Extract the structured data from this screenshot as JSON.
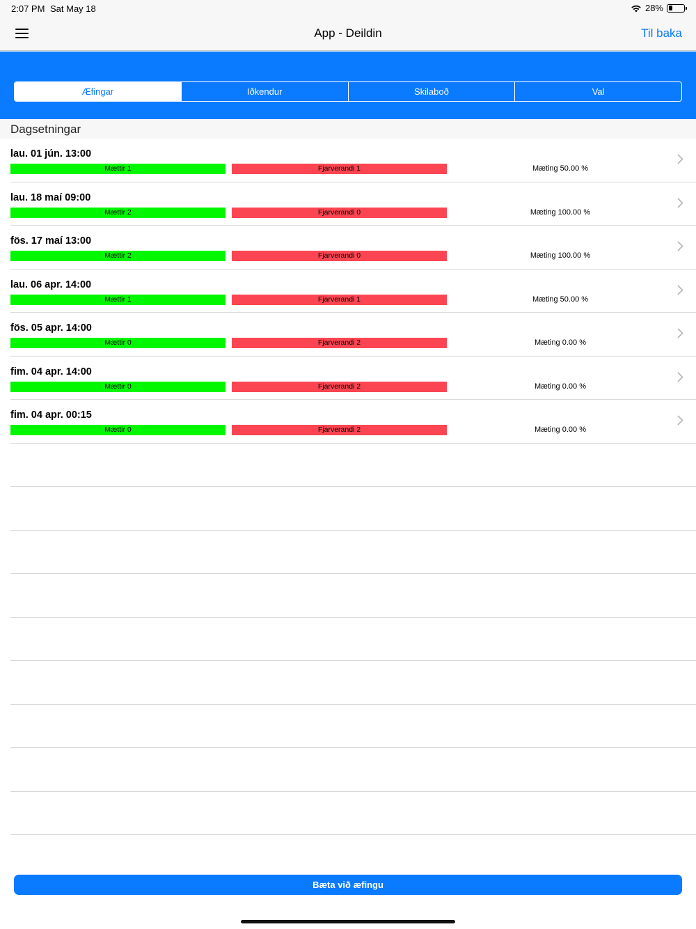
{
  "status_bar": {
    "time": "2:07 PM",
    "date": "Sat May 18",
    "battery": "28%"
  },
  "nav": {
    "title": "App - Deildin",
    "back_label": "Til baka"
  },
  "tabs": [
    {
      "label": "Æfingar",
      "active": true
    },
    {
      "label": "Iðkendur",
      "active": false
    },
    {
      "label": "Skilaboð",
      "active": false
    },
    {
      "label": "Val",
      "active": false
    }
  ],
  "section": {
    "header": "Dagsetningar"
  },
  "sessions": [
    {
      "date": "lau. 01 jún. 13:00",
      "present": "Mættir 1",
      "absent": "Fjarverandi 1",
      "attendance": "Mæting 50.00 %"
    },
    {
      "date": "lau. 18 maí 09:00",
      "present": "Mættir 2",
      "absent": "Fjarverandi 0",
      "attendance": "Mæting 100.00 %"
    },
    {
      "date": "fös. 17 maí 13:00",
      "present": "Mættir 2",
      "absent": "Fjarverandi 0",
      "attendance": "Mæting 100.00 %"
    },
    {
      "date": "lau. 06 apr. 14:00",
      "present": "Mættir 1",
      "absent": "Fjarverandi 1",
      "attendance": "Mæting 50.00 %"
    },
    {
      "date": "fös. 05 apr. 14:00",
      "present": "Mættir 0",
      "absent": "Fjarverandi 2",
      "attendance": "Mæting 0.00 %"
    },
    {
      "date": "fim. 04 apr. 14:00",
      "present": "Mættir 0",
      "absent": "Fjarverandi 2",
      "attendance": "Mæting 0.00 %"
    },
    {
      "date": "fim. 04 apr. 00:15",
      "present": "Mættir 0",
      "absent": "Fjarverandi 2",
      "attendance": "Mæting 0.00 %"
    }
  ],
  "footer": {
    "add_button_label": "Bæta við æfingu"
  },
  "colors": {
    "accent": "#0a7aff",
    "present": "#00f700",
    "absent": "#fc4552"
  }
}
